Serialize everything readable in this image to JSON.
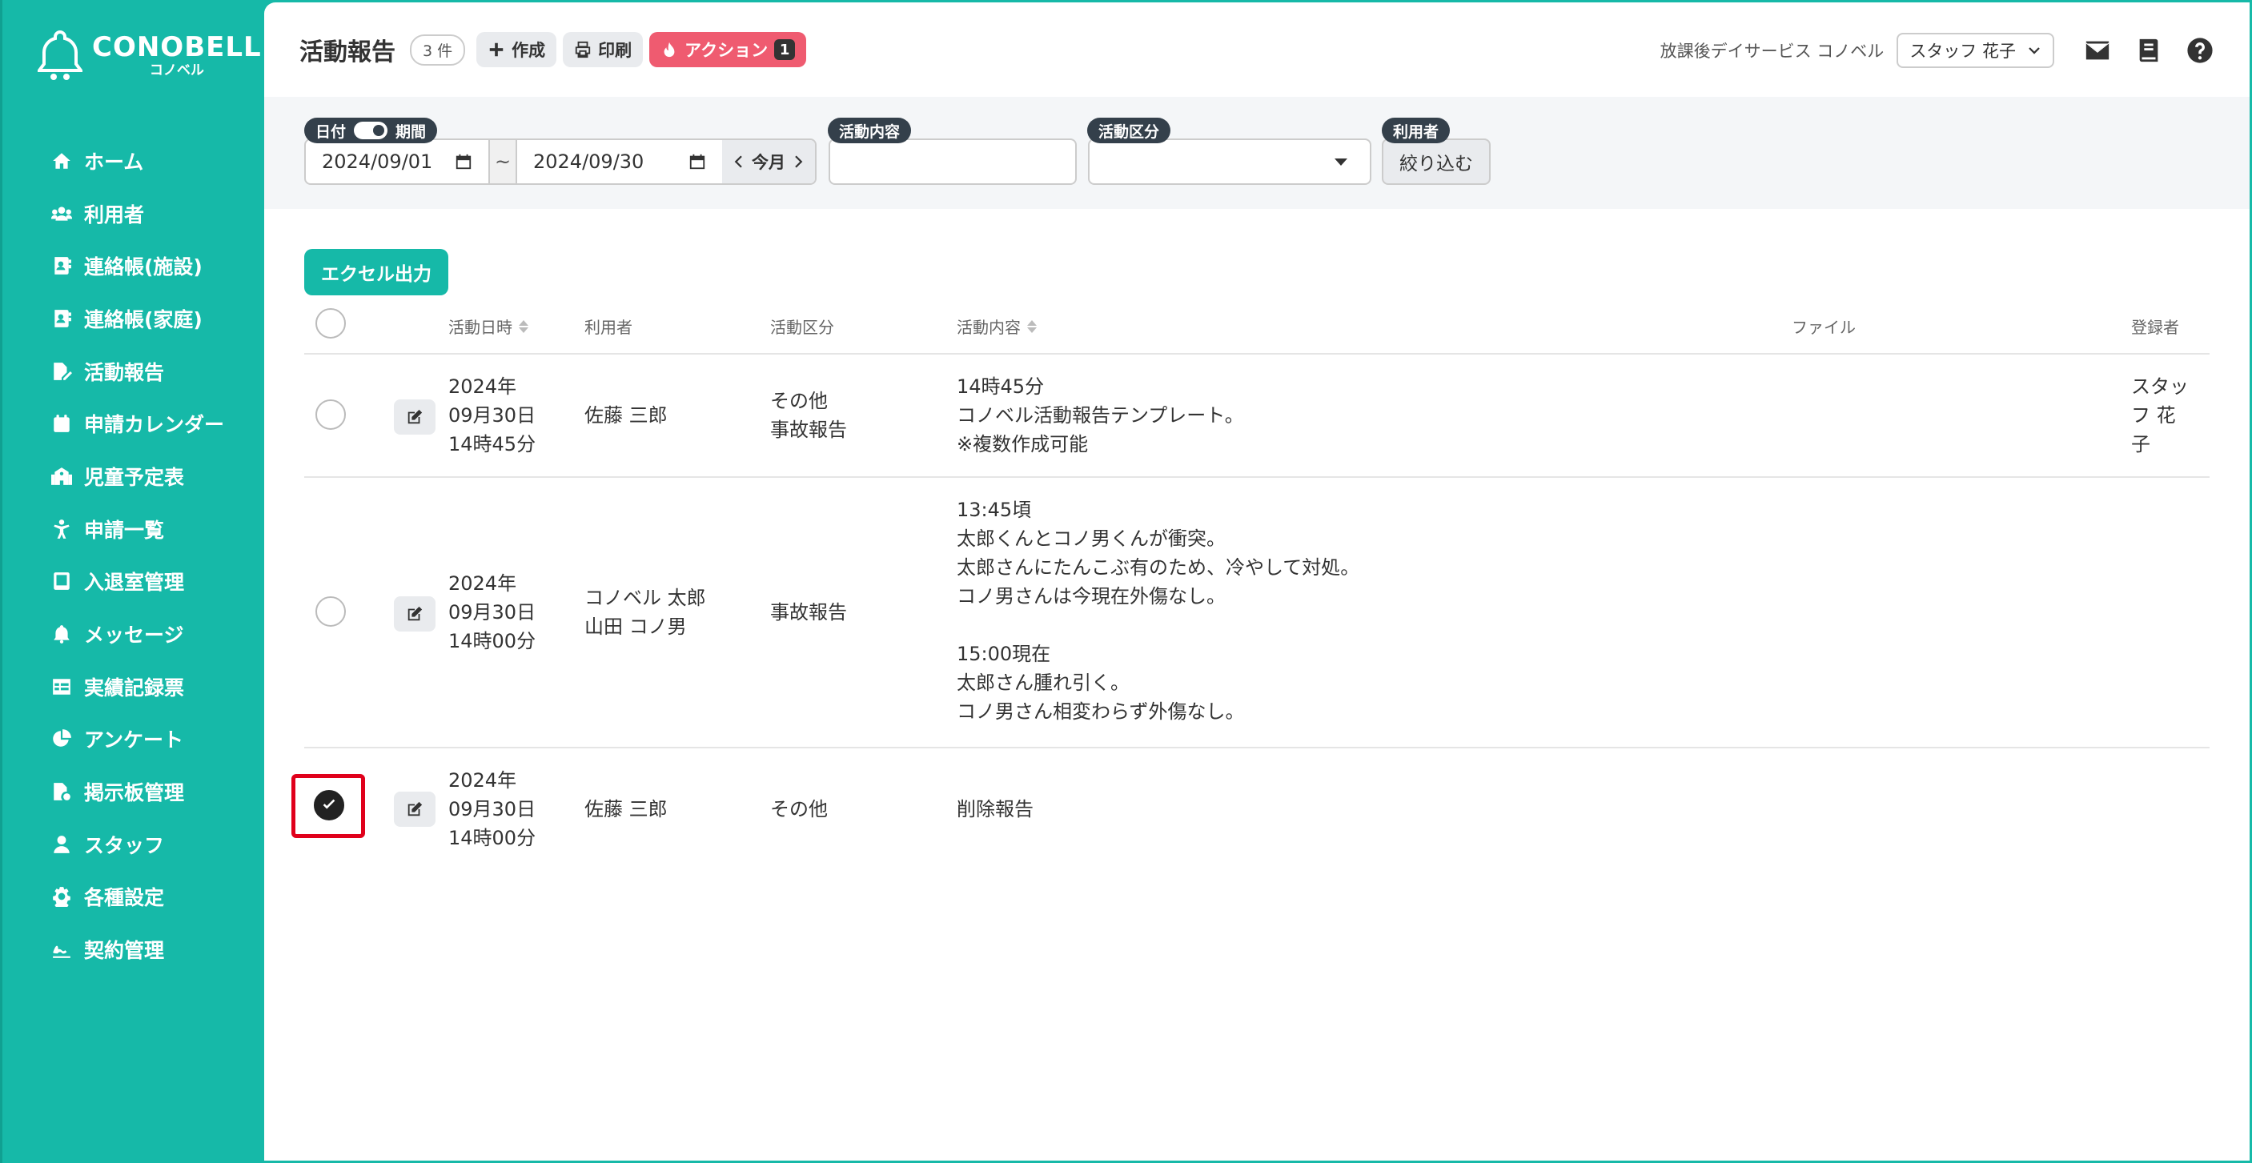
{
  "sidebar": {
    "logo_title": "CONOBELL",
    "logo_sub": "コノベル",
    "items": [
      {
        "label": "ホーム",
        "icon": "home-icon"
      },
      {
        "label": "利用者",
        "icon": "users-icon"
      },
      {
        "label": "連絡帳(施設)",
        "icon": "contact-book-icon"
      },
      {
        "label": "連絡帳(家庭)",
        "icon": "contact-book-icon"
      },
      {
        "label": "活動報告",
        "icon": "report-edit-icon"
      },
      {
        "label": "申請カレンダー",
        "icon": "calendar-icon"
      },
      {
        "label": "児童予定表",
        "icon": "school-icon"
      },
      {
        "label": "申請一覧",
        "icon": "child-icon"
      },
      {
        "label": "入退室管理",
        "icon": "tablet-icon"
      },
      {
        "label": "メッセージ",
        "icon": "bell-icon"
      },
      {
        "label": "実績記録票",
        "icon": "table-icon"
      },
      {
        "label": "アンケート",
        "icon": "pie-chart-icon"
      },
      {
        "label": "掲示板管理",
        "icon": "file-gear-icon"
      },
      {
        "label": "スタッフ",
        "icon": "person-icon"
      },
      {
        "label": "各種設定",
        "icon": "gear-icon"
      },
      {
        "label": "契約管理",
        "icon": "signature-icon"
      }
    ]
  },
  "header": {
    "title": "活動報告",
    "count": "3 件",
    "create_label": "作成",
    "print_label": "印刷",
    "action_label": "アクション",
    "action_count": "1",
    "facility": "放課後デイサービス コノベル",
    "staff": "スタッフ 花子"
  },
  "filters": {
    "date_label": "日付",
    "period_label": "期間",
    "start_date": "2024/09/01",
    "separator": "~",
    "end_date": "2024/09/30",
    "month_label": "今月",
    "content_label": "活動内容",
    "category_label": "活動区分",
    "user_label": "利用者",
    "filter_button": "絞り込む"
  },
  "excel_button": "エクセル出力",
  "table": {
    "columns": {
      "date": "活動日時",
      "user": "利用者",
      "category": "活動区分",
      "content": "活動内容",
      "file": "ファイル",
      "registrant": "登録者"
    },
    "rows": [
      {
        "date": [
          "2024年",
          "09月30日",
          "14時45分"
        ],
        "users": [
          "佐藤 三郎"
        ],
        "categories": [
          "その他",
          "事故報告"
        ],
        "content": [
          "14時45分",
          "コノベル活動報告テンプレート。",
          "※複数作成可能"
        ],
        "registrant": [
          "スタッ",
          "フ 花",
          "子"
        ],
        "checked": false
      },
      {
        "date": [
          "2024年",
          "09月30日",
          "14時00分"
        ],
        "users": [
          "コノベル 太郎",
          "山田 コノ男"
        ],
        "categories": [
          "事故報告"
        ],
        "content": [
          "13:45頃",
          "太郎くんとコノ男くんが衝突。",
          "太郎さんにたんこぶ有のため、冷やして対処。",
          "コノ男さんは今現在外傷なし。",
          "",
          "15:00現在",
          "太郎さん腫れ引く。",
          "コノ男さん相変わらず外傷なし。"
        ],
        "registrant": [],
        "checked": false
      },
      {
        "date": [
          "2024年",
          "09月30日",
          "14時00分"
        ],
        "users": [
          "佐藤 三郎"
        ],
        "categories": [
          "その他"
        ],
        "content": [
          "削除報告"
        ],
        "registrant": [],
        "checked": true
      }
    ]
  },
  "colors": {
    "brand": "#16b9a8",
    "action": "#ef5b70",
    "highlight": "#e0001b"
  }
}
